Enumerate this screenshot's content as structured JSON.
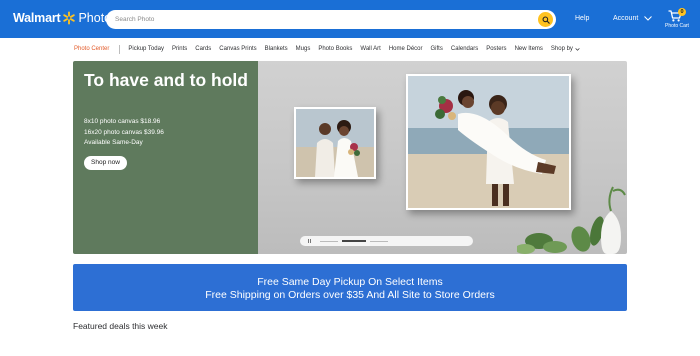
{
  "header": {
    "brand": "Walmart",
    "product": "Photo",
    "search_placeholder": "Search Photo",
    "help": "Help",
    "account": "Account",
    "cart_label": "Photo Cart",
    "cart_count": "0"
  },
  "nav": {
    "active": "Photo Center",
    "items": [
      "Pickup Today",
      "Prints",
      "Cards",
      "Canvas Prints",
      "Blankets",
      "Mugs",
      "Photo Books",
      "Wall Art",
      "Home Décor",
      "Gifts",
      "Calendars",
      "Posters",
      "New Items"
    ],
    "shop_by": "Shop by"
  },
  "hero": {
    "title": "To have and to hold",
    "line1": "8x10 photo canvas $18.96",
    "line2": "16x20 photo canvas $39.96",
    "line3": "Available Same-Day",
    "cta": "Shop now"
  },
  "promo": {
    "line1": "Free Same Day Pickup On Select Items",
    "line2": "Free Shipping on Orders over $35 And All Site to Store Orders"
  },
  "featured_heading": "Featured deals this week",
  "colors": {
    "header_blue": "#1a6fd6",
    "accent_yellow": "#ffc220",
    "hero_green": "#5f7a5d",
    "promo_blue": "#2d6fd4",
    "nav_active": "#e35b2a"
  }
}
